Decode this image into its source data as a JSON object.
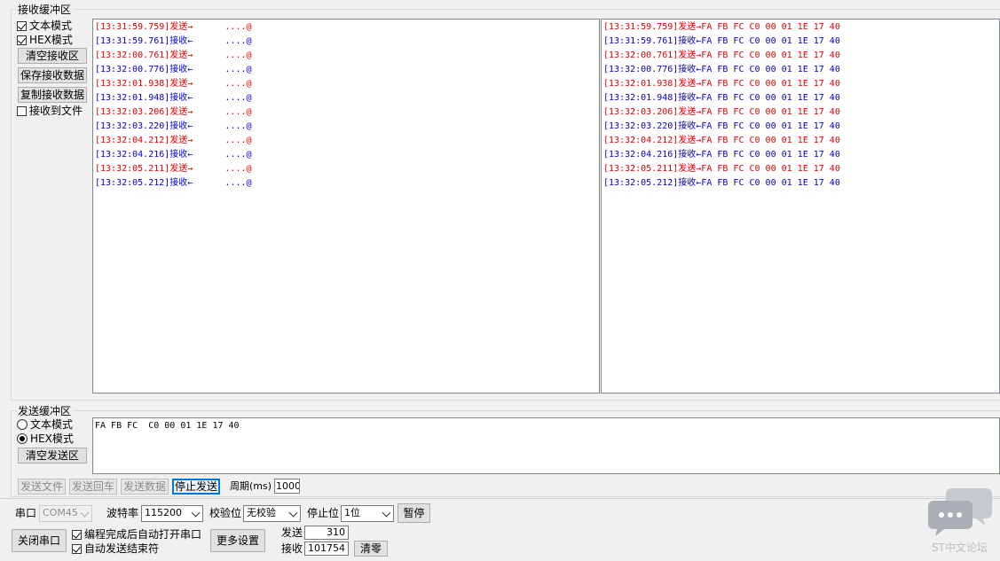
{
  "receive_area": {
    "title": "接收缓冲区",
    "text_mode_label": "文本模式",
    "hex_mode_label": "HEX模式",
    "clear_button": "清空接收区",
    "save_button": "保存接收数据",
    "copy_button": "复制接收数据",
    "to_file_label": "接收到文件",
    "text_mode_checked": true,
    "hex_mode_checked": true,
    "to_file_checked": false,
    "left_lines": [
      {
        "dir": "tx",
        "text": "[13:31:59.759]发送→      ....@"
      },
      {
        "dir": "rx",
        "text": "[13:31:59.761]接收←      ....@"
      },
      {
        "dir": "tx",
        "text": "[13:32:00.761]发送→      ....@"
      },
      {
        "dir": "rx",
        "text": "[13:32:00.776]接收←      ....@"
      },
      {
        "dir": "tx",
        "text": "[13:32:01.938]发送→      ....@"
      },
      {
        "dir": "rx",
        "text": "[13:32:01.948]接收←      ....@"
      },
      {
        "dir": "tx",
        "text": "[13:32:03.206]发送→      ....@"
      },
      {
        "dir": "rx",
        "text": "[13:32:03.220]接收←      ....@"
      },
      {
        "dir": "tx",
        "text": "[13:32:04.212]发送→      ....@"
      },
      {
        "dir": "rx",
        "text": "[13:32:04.216]接收←      ....@"
      },
      {
        "dir": "tx",
        "text": "[13:32:05.211]发送→      ....@"
      },
      {
        "dir": "rx",
        "text": "[13:32:05.212]接收←      ....@"
      }
    ],
    "right_lines": [
      {
        "dir": "tx",
        "text": "[13:31:59.759]发送→FA FB FC C0 00 01 1E 17 40"
      },
      {
        "dir": "rx",
        "text": "[13:31:59.761]接收←FA FB FC C0 00 01 1E 17 40"
      },
      {
        "dir": "tx",
        "text": "[13:32:00.761]发送→FA FB FC C0 00 01 1E 17 40"
      },
      {
        "dir": "rx",
        "text": "[13:32:00.776]接收←FA FB FC C0 00 01 1E 17 40"
      },
      {
        "dir": "tx",
        "text": "[13:32:01.938]发送→FA FB FC C0 00 01 1E 17 40"
      },
      {
        "dir": "rx",
        "text": "[13:32:01.948]接收←FA FB FC C0 00 01 1E 17 40"
      },
      {
        "dir": "tx",
        "text": "[13:32:03.206]发送→FA FB FC C0 00 01 1E 17 40"
      },
      {
        "dir": "rx",
        "text": "[13:32:03.220]接收←FA FB FC C0 00 01 1E 17 40"
      },
      {
        "dir": "tx",
        "text": "[13:32:04.212]发送→FA FB FC C0 00 01 1E 17 40"
      },
      {
        "dir": "rx",
        "text": "[13:32:04.216]接收←FA FB FC C0 00 01 1E 17 40"
      },
      {
        "dir": "tx",
        "text": "[13:32:05.211]发送→FA FB FC C0 00 01 1E 17 40"
      },
      {
        "dir": "rx",
        "text": "[13:32:05.212]接收←FA FB FC C0 00 01 1E 17 40"
      }
    ]
  },
  "send_area": {
    "title": "发送缓冲区",
    "text_mode_label": "文本模式",
    "hex_mode_label": "HEX模式",
    "clear_button": "清空发送区",
    "selected_mode": "hex",
    "content": "FA FB FC  C0 00 01 1E 17 40",
    "send_file_button": "发送文件",
    "send_enter_button": "发送回车",
    "send_data_button": "发送数据",
    "stop_send_button": "停止发送",
    "period_label": "周期(ms)",
    "period_value": "1000"
  },
  "port_settings": {
    "port_label": "串口",
    "port_value": "COM45",
    "baud_label": "波特率",
    "baud_value": "115200",
    "parity_label": "校验位",
    "parity_value": "无校验",
    "stopbits_label": "停止位",
    "stopbits_value": "1位",
    "pause_button": "暂停",
    "close_port_button": "关闭串口",
    "auto_open_label": "编程完成后自动打开串口",
    "auto_open_checked": true,
    "auto_end_label": "自动发送结束符",
    "auto_end_checked": true,
    "more_settings_button": "更多设置",
    "sent_label": "发送",
    "sent_count": "310",
    "recv_label": "接收",
    "recv_count": "101754",
    "clear_count_button": "清零"
  },
  "watermark": {
    "text": "ST中文论坛",
    "color": "#b9bec4"
  },
  "colors": {
    "tx": "#e00000",
    "rx": "#0000c8"
  }
}
